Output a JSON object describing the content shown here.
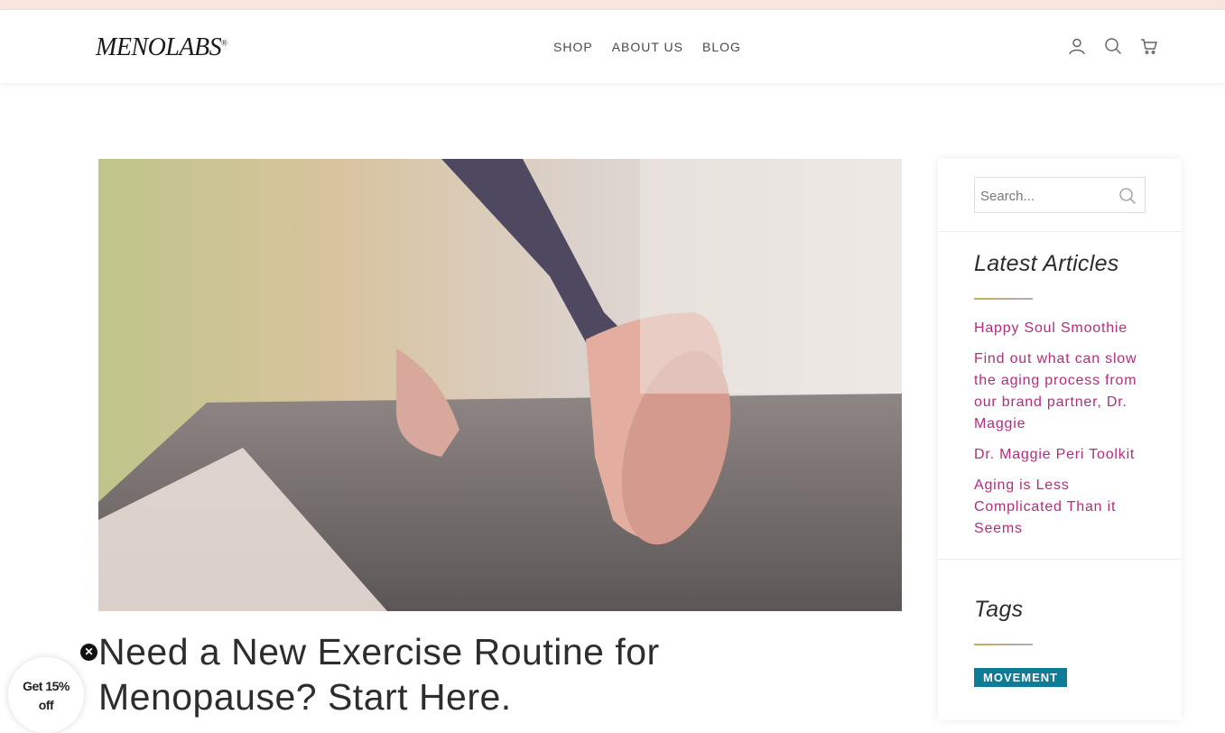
{
  "brand": {
    "logo_text": "MENOLABS",
    "logo_mark": "®"
  },
  "nav": {
    "items": [
      {
        "label": "SHOP"
      },
      {
        "label": "ABOUT US"
      },
      {
        "label": "BLOG"
      }
    ]
  },
  "header_icons": [
    "account-icon",
    "search-icon",
    "cart-icon"
  ],
  "article": {
    "title": "Need a New Exercise Routine for Menopause? Start Here."
  },
  "sidebar": {
    "search": {
      "placeholder": "Search..."
    },
    "latest_heading": "Latest Articles",
    "articles": [
      {
        "label": "Happy Soul Smoothie"
      },
      {
        "label": "Find out what can slow the aging process from our brand partner, Dr. Maggie"
      },
      {
        "label": "Dr. Maggie Peri Toolkit"
      },
      {
        "label": "Aging is Less Complicated Than it Seems"
      }
    ],
    "tags_heading": "Tags",
    "tags": [
      {
        "label": "MOVEMENT"
      }
    ]
  },
  "promo": {
    "line1": "Get 15%",
    "line2": "off",
    "close_glyph": "✕"
  },
  "colors": {
    "link": "#b52c7d",
    "tag_bg": "#0f7c97",
    "topbar": "#f6e6de",
    "accent_line": "#c3b04f"
  }
}
